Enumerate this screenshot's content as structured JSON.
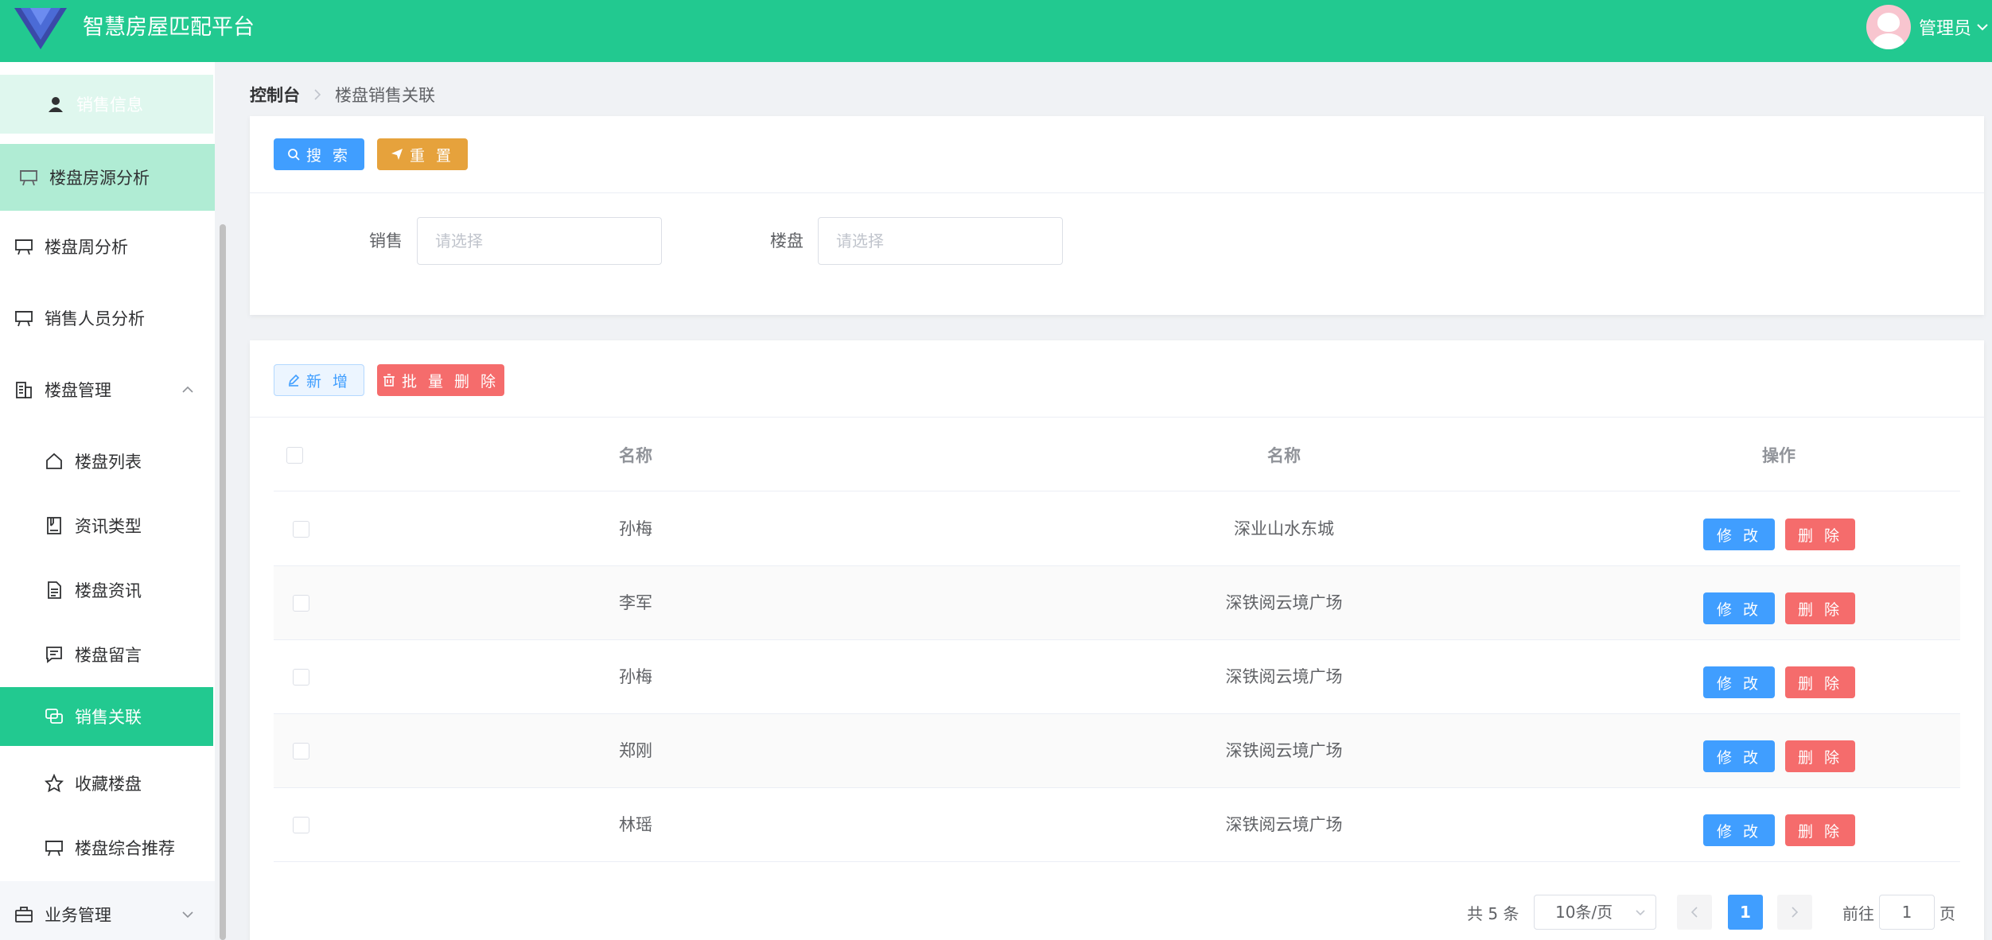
{
  "header": {
    "title": "智慧房屋匹配平台",
    "user_name": "管理员"
  },
  "sidebar": {
    "items": [
      {
        "label": "销售信息",
        "icon": "user-icon",
        "state": "sub-active"
      },
      {
        "label": "楼盘房源分析",
        "icon": "presentation-icon",
        "state": "active-parent"
      },
      {
        "label": "楼盘周分析",
        "icon": "presentation-icon"
      },
      {
        "label": "销售人员分析",
        "icon": "presentation-icon"
      },
      {
        "label": "楼盘管理",
        "icon": "building-icon",
        "expanded": true
      },
      {
        "label": "楼盘列表",
        "icon": "house-icon"
      },
      {
        "label": "资讯类型",
        "icon": "notebook-icon"
      },
      {
        "label": "楼盘资讯",
        "icon": "document-icon"
      },
      {
        "label": "楼盘留言",
        "icon": "chat-icon"
      },
      {
        "label": "销售关联",
        "icon": "chat-dot-icon",
        "state": "selected"
      },
      {
        "label": "收藏楼盘",
        "icon": "star-icon"
      },
      {
        "label": "楼盘综合推荐",
        "icon": "presentation-icon"
      },
      {
        "label": "业务管理",
        "icon": "briefcase-icon",
        "expanded": false
      }
    ]
  },
  "breadcrumb": {
    "home": "控制台",
    "current": "楼盘销售关联"
  },
  "search_panel": {
    "search_label": "搜 索",
    "reset_label": "重 置",
    "sale_label": "销售",
    "sale_placeholder": "请选择",
    "loupan_label": "楼盘",
    "loupan_placeholder": "请选择"
  },
  "toolbar": {
    "add_label": "新 增",
    "batch_delete_label": "批 量 删 除"
  },
  "table": {
    "columns": [
      "名称",
      "名称",
      "操作"
    ],
    "rows": [
      {
        "name": "孙梅",
        "loupan": "深业山水东城"
      },
      {
        "name": "李军",
        "loupan": "深铁阅云境广场"
      },
      {
        "name": "孙梅",
        "loupan": "深铁阅云境广场"
      },
      {
        "name": "郑刚",
        "loupan": "深铁阅云境广场"
      },
      {
        "name": "林瑶",
        "loupan": "深铁阅云境广场"
      }
    ],
    "edit_label": "修 改",
    "delete_label": "删 除"
  },
  "pagination": {
    "total_text": "共 5 条",
    "page_size": "10条/页",
    "current_page": "1",
    "goto_label": "前往",
    "goto_value": "1",
    "page_suffix": "页"
  },
  "colors": {
    "brand": "#22c990",
    "primary": "#409eff",
    "warning": "#e6a23c",
    "danger": "#f56c6c"
  }
}
